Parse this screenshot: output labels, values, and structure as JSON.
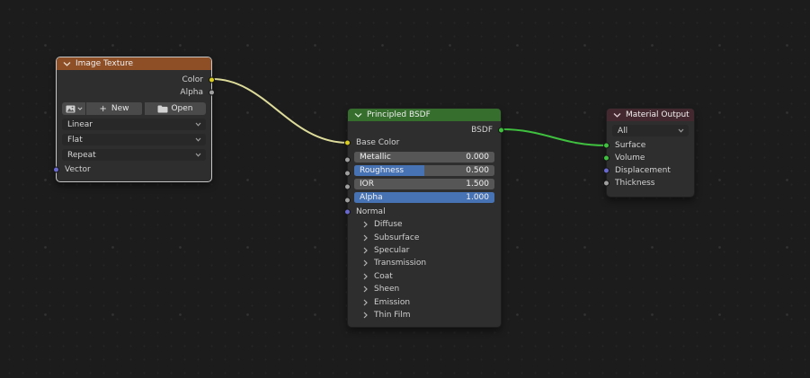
{
  "editor": {
    "type": "Shader Node Editor",
    "background_color": "#1c1c1c",
    "slider_fill_color": "#4772b3"
  },
  "nodes": {
    "image_texture": {
      "title": "Image Texture",
      "header_color": "#8f4f26",
      "selected": true,
      "outputs": [
        {
          "label": "Color",
          "color": "#d8cc20"
        },
        {
          "label": "Alpha",
          "color": "#9f9f9f"
        }
      ],
      "image_selector": {
        "browse_icon": "image-icon",
        "plus": "+",
        "new_label": "New",
        "open_label": "Open"
      },
      "interpolation": "Linear",
      "projection": "Flat",
      "extension": "Repeat",
      "inputs": [
        {
          "label": "Vector",
          "color": "#6868cf"
        }
      ]
    },
    "principled_bsdf": {
      "title": "Principled BSDF",
      "header_color": "#356e2d",
      "selected": false,
      "outputs": [
        {
          "label": "BSDF",
          "color": "#3fc13f"
        }
      ],
      "base_color": {
        "label": "Base Color",
        "color": "#d8cc20"
      },
      "sliders": [
        {
          "label": "Metallic",
          "value": "0.000",
          "fill": 0,
          "socket_color": "#9f9f9f"
        },
        {
          "label": "Roughness",
          "value": "0.500",
          "fill": 0.5,
          "socket_color": "#9f9f9f"
        },
        {
          "label": "IOR",
          "value": "1.500",
          "fill": 0,
          "socket_color": "#9f9f9f"
        },
        {
          "label": "Alpha",
          "value": "1.000",
          "fill": 1,
          "socket_color": "#9f9f9f"
        }
      ],
      "normal": {
        "label": "Normal",
        "color": "#6868cf"
      },
      "panels": [
        "Diffuse",
        "Subsurface",
        "Specular",
        "Transmission",
        "Coat",
        "Sheen",
        "Emission",
        "Thin Film"
      ]
    },
    "material_output": {
      "title": "Material Output",
      "header_color": "#44282f",
      "selected": false,
      "target": "All",
      "inputs": [
        {
          "label": "Surface",
          "color": "#3fc13f"
        },
        {
          "label": "Volume",
          "color": "#3fc13f"
        },
        {
          "label": "Displacement",
          "color": "#6868cf"
        },
        {
          "label": "Thickness",
          "color": "#9f9f9f"
        }
      ]
    }
  },
  "links": [
    {
      "from": "Image Texture / Color",
      "to": "Principled BSDF / Base Color",
      "color": "#dedc9a"
    },
    {
      "from": "Principled BSDF / BSDF",
      "to": "Material Output / Surface",
      "color": "#3fc13f"
    }
  ]
}
